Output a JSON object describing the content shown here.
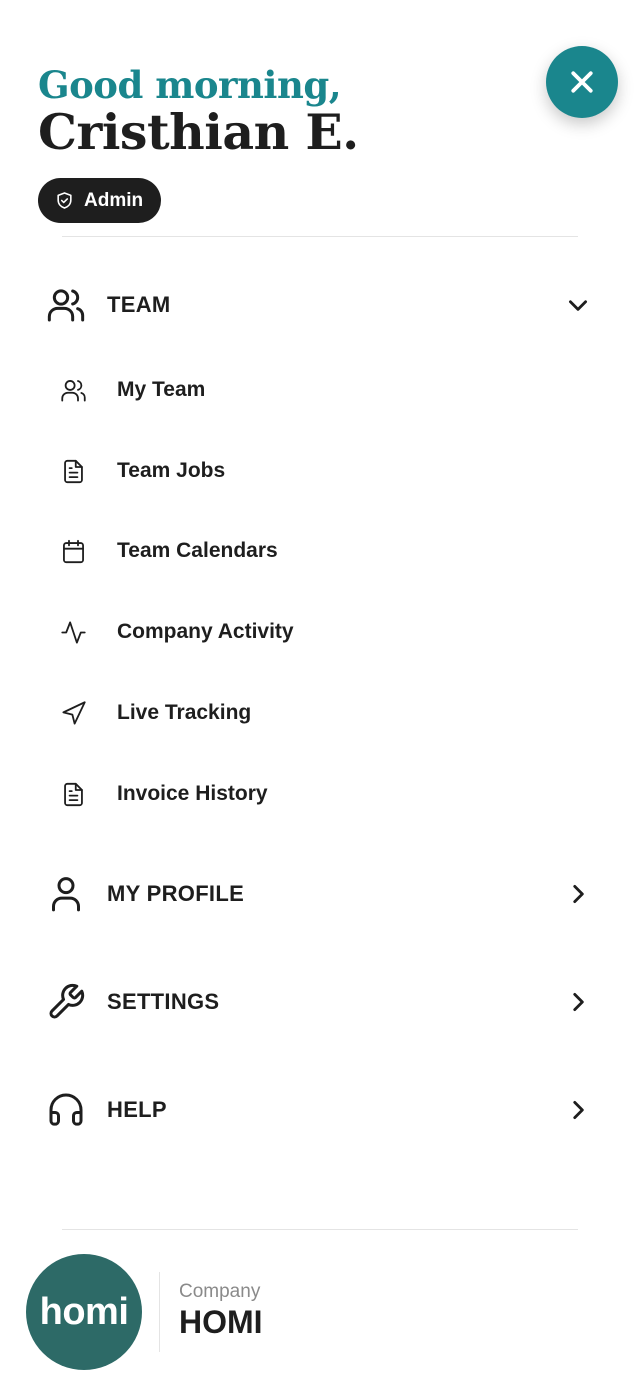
{
  "header": {
    "greeting": "Good morning,",
    "user_name": "Cristhian E.",
    "role_badge": "Admin",
    "close_icon": "close-icon"
  },
  "menu": {
    "team": {
      "label": "TEAM",
      "icon": "users-icon",
      "expanded": true,
      "items": [
        {
          "label": "My Team",
          "icon": "users-icon"
        },
        {
          "label": "Team Jobs",
          "icon": "document-icon"
        },
        {
          "label": "Team Calendars",
          "icon": "calendar-icon"
        },
        {
          "label": "Company Activity",
          "icon": "activity-icon"
        },
        {
          "label": "Live Tracking",
          "icon": "navigation-icon"
        },
        {
          "label": "Invoice History",
          "icon": "document-icon"
        }
      ]
    },
    "my_profile": {
      "label": "MY PROFILE",
      "icon": "user-icon"
    },
    "settings": {
      "label": "SETTINGS",
      "icon": "wrench-icon"
    },
    "help": {
      "label": "HELP",
      "icon": "headset-icon"
    }
  },
  "footer": {
    "logo_text": "homi",
    "company_caption": "Company",
    "company_name": "HOMI"
  },
  "colors": {
    "accent": "#1a868d",
    "dark": "#1e1e1e",
    "logo_bg": "#2d6a67",
    "caption": "#8a8a8a"
  }
}
